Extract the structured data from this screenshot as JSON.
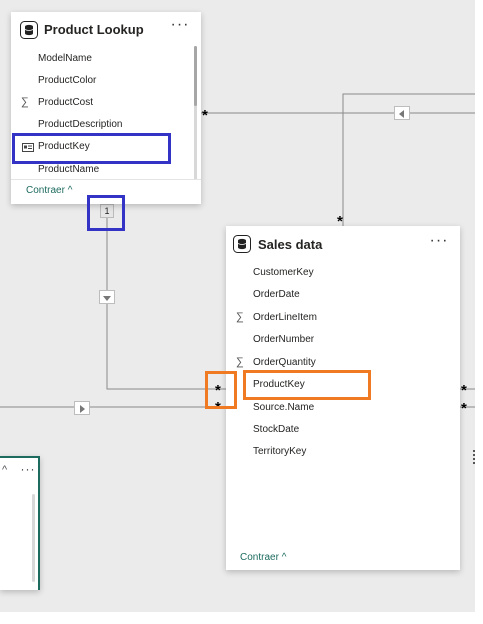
{
  "colors": {
    "highlight_blue": "#3333c5",
    "highlight_orange": "#f07a22",
    "collapse_link": "#1d6b5f",
    "relationship_line": "#8a8a8a",
    "canvas_background": "#ebebeb"
  },
  "product_lookup": {
    "title": "Product Lookup",
    "icon": "table-icon",
    "more": "···",
    "fields": [
      {
        "name": "ModelName",
        "icon": ""
      },
      {
        "name": "ProductColor",
        "icon": ""
      },
      {
        "name": "ProductCost",
        "icon": "sigma-icon"
      },
      {
        "name": "ProductDescription",
        "icon": ""
      },
      {
        "name": "ProductKey",
        "icon": "key-card-icon"
      },
      {
        "name": "ProductName",
        "icon": ""
      }
    ],
    "collapse_label": "Contraer",
    "collapse_chevron": "^"
  },
  "sales_data": {
    "title": "Sales data",
    "icon": "table-icon",
    "more": "···",
    "fields": [
      {
        "name": "CustomerKey",
        "icon": ""
      },
      {
        "name": "OrderDate",
        "icon": ""
      },
      {
        "name": "OrderLineItem",
        "icon": "sigma-icon"
      },
      {
        "name": "OrderNumber",
        "icon": ""
      },
      {
        "name": "OrderQuantity",
        "icon": "sigma-icon"
      },
      {
        "name": "ProductKey",
        "icon": ""
      },
      {
        "name": "Source.Name",
        "icon": ""
      },
      {
        "name": "StockDate",
        "icon": ""
      },
      {
        "name": "TerritoryKey",
        "icon": ""
      }
    ],
    "collapse_label": "Contraer",
    "collapse_chevron": "^"
  },
  "relationships": {
    "many_symbol": "*",
    "one_symbol": "1",
    "sigma": "∑"
  }
}
